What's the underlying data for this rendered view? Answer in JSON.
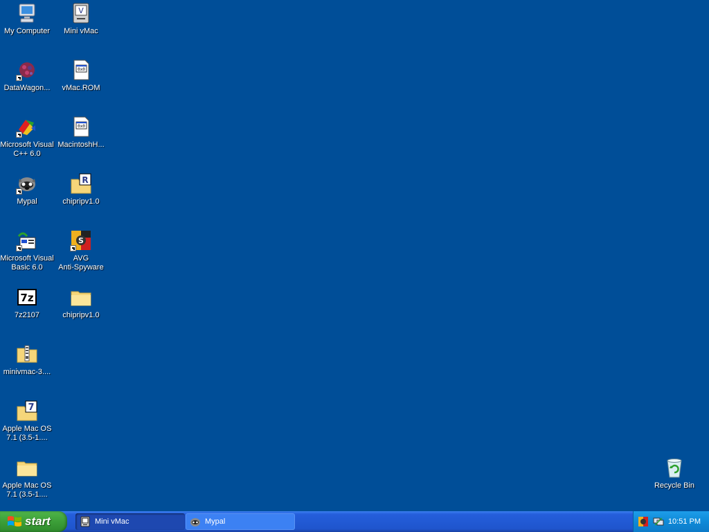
{
  "desktop": {
    "icons": [
      {
        "label": "My Computer",
        "icon": "my-computer-icon"
      },
      {
        "label": "Mini vMac",
        "icon": "mini-vmac-icon"
      },
      {
        "label": "DataWagon...",
        "icon": "datawagon-icon"
      },
      {
        "label": "vMac.ROM",
        "icon": "rom-file-icon"
      },
      {
        "label": "Microsoft Visual\nC++ 6.0",
        "icon": "visual-cpp-icon"
      },
      {
        "label": "MacintoshH...",
        "icon": "disk-image-file-icon"
      },
      {
        "label": "Mypal",
        "icon": "mypal-icon"
      },
      {
        "label": "chipripv1.0",
        "icon": "winrar-folder-icon"
      },
      {
        "label": "Microsoft Visual\nBasic 6.0",
        "icon": "visual-basic-icon"
      },
      {
        "label": "AVG\nAnti-Spyware",
        "icon": "avg-antispyware-icon"
      },
      {
        "label": "7z2107",
        "icon": "7zip-icon"
      },
      {
        "label": "chipripv1.0",
        "icon": "folder-icon"
      },
      {
        "label": "minivmac-3....",
        "icon": "zip-folder-icon"
      },
      {
        "label": "Apple Mac OS\n7.1 (3.5-1....",
        "icon": "7z-archive-icon"
      },
      {
        "label": "Apple Mac OS\n7.1 (3.5-1....",
        "icon": "folder-icon"
      },
      {
        "label": "Recycle Bin",
        "icon": "recycle-bin-icon"
      }
    ]
  },
  "taskbar": {
    "start_label": "start",
    "tasks": [
      {
        "label": "Mini vMac",
        "icon": "mini-vmac-icon",
        "active": true
      },
      {
        "label": "Mypal",
        "icon": "mypal-icon",
        "active": false
      }
    ],
    "tray": {
      "icons": [
        "avg-antispyware-tray-icon",
        "network-tray-icon"
      ],
      "clock": "10:51 PM"
    }
  },
  "colors": {
    "desktop_background": "#004e98",
    "taskbar": "#245edb",
    "start_button": "#3c9f38",
    "tray": "#0f8ad8"
  }
}
